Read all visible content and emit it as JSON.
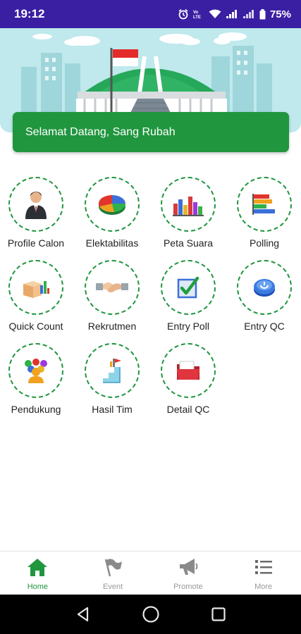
{
  "status_bar": {
    "time": "19:12",
    "battery": "75%"
  },
  "welcome": {
    "text": "Selamat Datang, Sang Rubah"
  },
  "menu": [
    {
      "label": "Profile Calon",
      "icon": "person-icon"
    },
    {
      "label": "Elektabilitas",
      "icon": "pie-chart-icon"
    },
    {
      "label": "Peta Suara",
      "icon": "bar-chart-icon"
    },
    {
      "label": "Polling",
      "icon": "poll-bars-icon"
    },
    {
      "label": "Quick Count",
      "icon": "box-chart-icon"
    },
    {
      "label": "Rekrutmen",
      "icon": "handshake-icon"
    },
    {
      "label": "Entry Poll",
      "icon": "checkbox-icon"
    },
    {
      "label": "Entry QC",
      "icon": "power-button-icon"
    },
    {
      "label": "Pendukung",
      "icon": "group-icon"
    },
    {
      "label": "Hasil Tim",
      "icon": "stairs-icon"
    },
    {
      "label": "Detail QC",
      "icon": "folder-icon"
    }
  ],
  "bottom_nav": [
    {
      "label": "Home",
      "icon": "home-icon",
      "active": true
    },
    {
      "label": "Event",
      "icon": "flag-icon",
      "active": false
    },
    {
      "label": "Promote",
      "icon": "megaphone-icon",
      "active": false
    },
    {
      "label": "More",
      "icon": "list-icon",
      "active": false
    }
  ],
  "colors": {
    "primary": "#20963f",
    "status_bar": "#3a1fa3",
    "hero_bg": "#bfe9ec"
  }
}
